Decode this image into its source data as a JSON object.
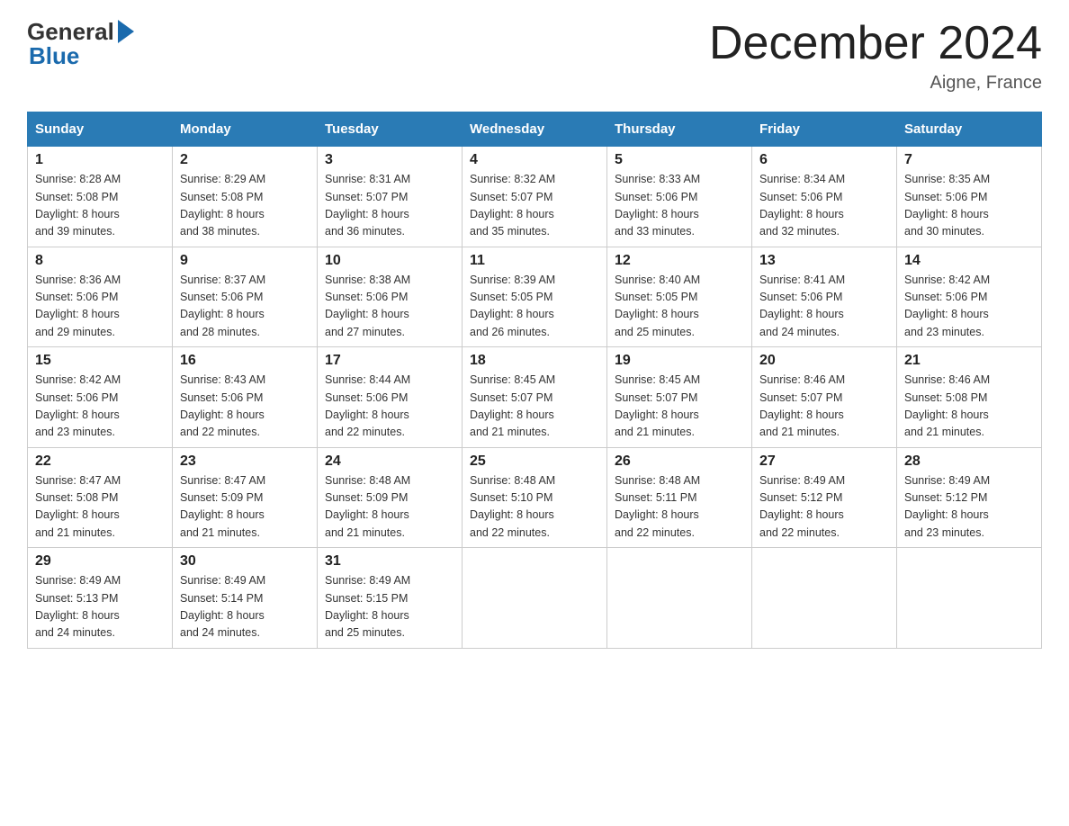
{
  "logo": {
    "general": "General",
    "blue": "Blue"
  },
  "title": "December 2024",
  "location": "Aigne, France",
  "days_of_week": [
    "Sunday",
    "Monday",
    "Tuesday",
    "Wednesday",
    "Thursday",
    "Friday",
    "Saturday"
  ],
  "weeks": [
    [
      {
        "num": "1",
        "sunrise": "8:28 AM",
        "sunset": "5:08 PM",
        "daylight": "8 hours and 39 minutes."
      },
      {
        "num": "2",
        "sunrise": "8:29 AM",
        "sunset": "5:08 PM",
        "daylight": "8 hours and 38 minutes."
      },
      {
        "num": "3",
        "sunrise": "8:31 AM",
        "sunset": "5:07 PM",
        "daylight": "8 hours and 36 minutes."
      },
      {
        "num": "4",
        "sunrise": "8:32 AM",
        "sunset": "5:07 PM",
        "daylight": "8 hours and 35 minutes."
      },
      {
        "num": "5",
        "sunrise": "8:33 AM",
        "sunset": "5:06 PM",
        "daylight": "8 hours and 33 minutes."
      },
      {
        "num": "6",
        "sunrise": "8:34 AM",
        "sunset": "5:06 PM",
        "daylight": "8 hours and 32 minutes."
      },
      {
        "num": "7",
        "sunrise": "8:35 AM",
        "sunset": "5:06 PM",
        "daylight": "8 hours and 30 minutes."
      }
    ],
    [
      {
        "num": "8",
        "sunrise": "8:36 AM",
        "sunset": "5:06 PM",
        "daylight": "8 hours and 29 minutes."
      },
      {
        "num": "9",
        "sunrise": "8:37 AM",
        "sunset": "5:06 PM",
        "daylight": "8 hours and 28 minutes."
      },
      {
        "num": "10",
        "sunrise": "8:38 AM",
        "sunset": "5:06 PM",
        "daylight": "8 hours and 27 minutes."
      },
      {
        "num": "11",
        "sunrise": "8:39 AM",
        "sunset": "5:05 PM",
        "daylight": "8 hours and 26 minutes."
      },
      {
        "num": "12",
        "sunrise": "8:40 AM",
        "sunset": "5:05 PM",
        "daylight": "8 hours and 25 minutes."
      },
      {
        "num": "13",
        "sunrise": "8:41 AM",
        "sunset": "5:06 PM",
        "daylight": "8 hours and 24 minutes."
      },
      {
        "num": "14",
        "sunrise": "8:42 AM",
        "sunset": "5:06 PM",
        "daylight": "8 hours and 23 minutes."
      }
    ],
    [
      {
        "num": "15",
        "sunrise": "8:42 AM",
        "sunset": "5:06 PM",
        "daylight": "8 hours and 23 minutes."
      },
      {
        "num": "16",
        "sunrise": "8:43 AM",
        "sunset": "5:06 PM",
        "daylight": "8 hours and 22 minutes."
      },
      {
        "num": "17",
        "sunrise": "8:44 AM",
        "sunset": "5:06 PM",
        "daylight": "8 hours and 22 minutes."
      },
      {
        "num": "18",
        "sunrise": "8:45 AM",
        "sunset": "5:07 PM",
        "daylight": "8 hours and 21 minutes."
      },
      {
        "num": "19",
        "sunrise": "8:45 AM",
        "sunset": "5:07 PM",
        "daylight": "8 hours and 21 minutes."
      },
      {
        "num": "20",
        "sunrise": "8:46 AM",
        "sunset": "5:07 PM",
        "daylight": "8 hours and 21 minutes."
      },
      {
        "num": "21",
        "sunrise": "8:46 AM",
        "sunset": "5:08 PM",
        "daylight": "8 hours and 21 minutes."
      }
    ],
    [
      {
        "num": "22",
        "sunrise": "8:47 AM",
        "sunset": "5:08 PM",
        "daylight": "8 hours and 21 minutes."
      },
      {
        "num": "23",
        "sunrise": "8:47 AM",
        "sunset": "5:09 PM",
        "daylight": "8 hours and 21 minutes."
      },
      {
        "num": "24",
        "sunrise": "8:48 AM",
        "sunset": "5:09 PM",
        "daylight": "8 hours and 21 minutes."
      },
      {
        "num": "25",
        "sunrise": "8:48 AM",
        "sunset": "5:10 PM",
        "daylight": "8 hours and 22 minutes."
      },
      {
        "num": "26",
        "sunrise": "8:48 AM",
        "sunset": "5:11 PM",
        "daylight": "8 hours and 22 minutes."
      },
      {
        "num": "27",
        "sunrise": "8:49 AM",
        "sunset": "5:12 PM",
        "daylight": "8 hours and 22 minutes."
      },
      {
        "num": "28",
        "sunrise": "8:49 AM",
        "sunset": "5:12 PM",
        "daylight": "8 hours and 23 minutes."
      }
    ],
    [
      {
        "num": "29",
        "sunrise": "8:49 AM",
        "sunset": "5:13 PM",
        "daylight": "8 hours and 24 minutes."
      },
      {
        "num": "30",
        "sunrise": "8:49 AM",
        "sunset": "5:14 PM",
        "daylight": "8 hours and 24 minutes."
      },
      {
        "num": "31",
        "sunrise": "8:49 AM",
        "sunset": "5:15 PM",
        "daylight": "8 hours and 25 minutes."
      },
      null,
      null,
      null,
      null
    ]
  ],
  "labels": {
    "sunrise": "Sunrise:",
    "sunset": "Sunset:",
    "daylight": "Daylight:"
  }
}
